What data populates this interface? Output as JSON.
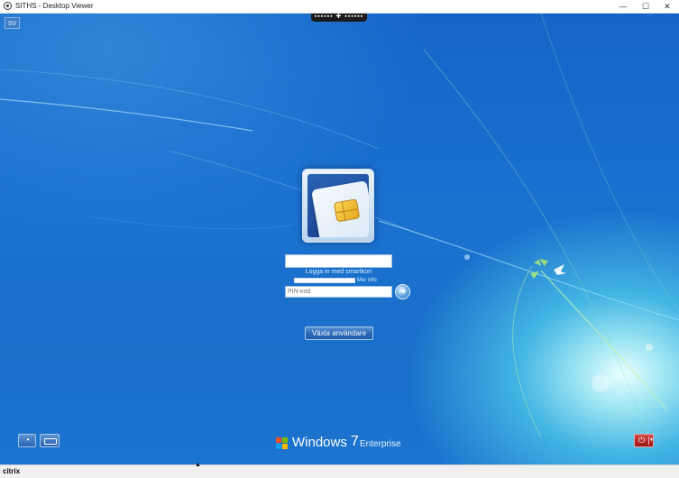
{
  "window": {
    "title": "SITHS - Desktop Viewer",
    "minimize": "—",
    "maximize": "☐",
    "close": "✕"
  },
  "viewer_toolbar": {
    "label": "▪▪▪▪▪▪ ✚ ▪▪▪▪▪▪"
  },
  "corner_badge": "SV",
  "login": {
    "username_value": "",
    "method_label": "Logga in med smartkort",
    "domain_value": "",
    "domain_label": "Mer info",
    "pin_placeholder": "PIN-kod",
    "pin_value": "",
    "submit_glyph": "➜",
    "switch_user_label": "Växla användare"
  },
  "bottom_controls": {
    "ease_glyph": "◔",
    "power_glyph": "⏻",
    "power_menu_glyph": "▾"
  },
  "branding": {
    "product": "Windows",
    "version": "7",
    "edition": "Enterprise"
  },
  "statusbar": {
    "logo": "citrix"
  },
  "colors": {
    "desktop_blue": "#1a6fc9",
    "power_red": "#b21e1e",
    "flag": [
      "#f25022",
      "#7fba00",
      "#00a4ef",
      "#ffb900"
    ]
  }
}
